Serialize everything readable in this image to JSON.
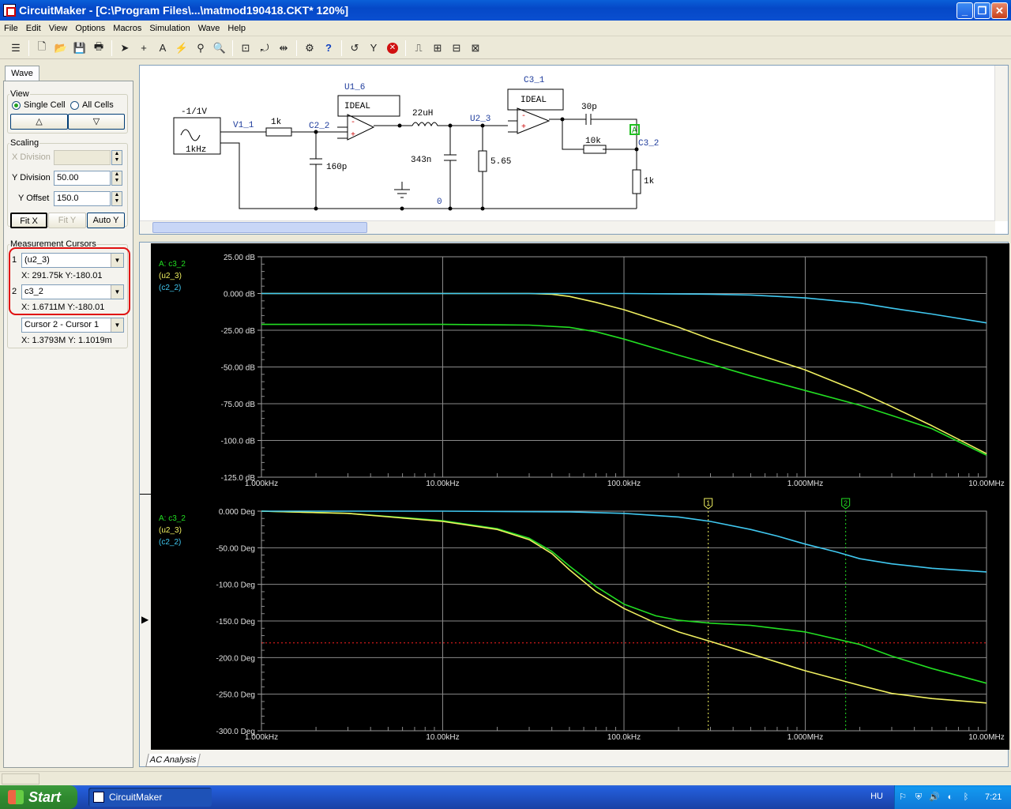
{
  "window": {
    "title": "CircuitMaker - [C:\\Program Files\\...\\matmod190418.CKT* 120%]",
    "minimize": "_",
    "restore": "❐",
    "close": "✕"
  },
  "menu": [
    "File",
    "Edit",
    "View",
    "Options",
    "Macros",
    "Simulation",
    "Wave",
    "Help"
  ],
  "toolbar_icons": [
    "bus-icon",
    "new-file-icon",
    "open-folder-icon",
    "save-icon",
    "print-icon",
    "arrow-tool-icon",
    "wire-tool-icon",
    "text-tool-icon",
    "probe-tool-icon",
    "zoom-tool-icon",
    "magnifier-icon",
    "zoom-to-fit-icon",
    "rotate-icon",
    "mirror-icon",
    "digital-sim-icon",
    "help-icon",
    "reset-icon",
    "step-icon",
    "stop-icon",
    "trace-icon",
    "waveform-icon",
    "scope-icon",
    "analog-icon"
  ],
  "left_panel": {
    "tab": "Wave",
    "view": {
      "legend": "View",
      "single_cell": "Single Cell",
      "all_cells": "All Cells",
      "up": "△",
      "down": "▽"
    },
    "scaling": {
      "legend": "Scaling",
      "x_division_label": "X Division",
      "x_division_value": "",
      "y_division_label": "Y Division",
      "y_division_value": "50.00",
      "y_offset_label": "Y Offset",
      "y_offset_value": "150.0",
      "fit_x": "Fit X",
      "fit_y": "Fit Y",
      "auto_y": "Auto Y"
    },
    "cursors": {
      "legend": "Measurement Cursors",
      "c1_num": "1",
      "c1_signal": "(u2_3)",
      "c1_readout": "X: 291.75k  Y:-180.01",
      "c2_num": "2",
      "c2_signal": "c3_2",
      "c2_readout": "X: 1.6711M  Y:-180.01",
      "diff_mode": "Cursor 2 - Cursor 1",
      "diff_readout": "X: 1.3793M  Y: 1.1019m"
    }
  },
  "schematic": {
    "source_amp": "-1/1V",
    "source_freq": "1kHz",
    "net_v1": "V1_1",
    "r1": "1k",
    "net_c22": "C2_2",
    "c1": "160p",
    "u1": "U1_6",
    "u1_type": "IDEAL",
    "l1": "22uH",
    "c2": "343n",
    "ground_net": "0",
    "net_u23": "U2_3",
    "r2": "5.65",
    "u2": "C3_1",
    "u2_type": "IDEAL",
    "c3": "30p",
    "r3": "10k",
    "probe": "A",
    "net_c32": "C3_2",
    "r4": "1k"
  },
  "colors": {
    "green": "#22dd22",
    "yellow": "#f0f060",
    "cyan": "#40c8f0",
    "red_cursor": "#ff2020"
  },
  "chart_data": [
    {
      "type": "line",
      "title": "",
      "xscale": "log",
      "xlim": [
        1000,
        10000000
      ],
      "ylim": [
        -125,
        25
      ],
      "x_ticks": [
        "1.000kHz",
        "10.00kHz",
        "100.0kHz",
        "1.000MHz",
        "10.00MHz"
      ],
      "y_ticks": [
        "25.00 dB",
        "0.000 dB",
        "-25.00 dB",
        "-50.00 dB",
        "-75.00 dB",
        "-100.0 dB",
        "-125.0 dB"
      ],
      "legend": [
        "A: c3_2",
        "(u2_3)",
        "(c2_2)"
      ],
      "series": [
        {
          "name": "A: c3_2",
          "color": "#22dd22",
          "x": [
            1000,
            10000,
            30000,
            50000,
            70000,
            100000,
            200000,
            300000,
            500000,
            1000000,
            2000000,
            3000000,
            5000000,
            10000000
          ],
          "y": [
            -21,
            -21,
            -21.5,
            -23,
            -26,
            -31,
            -42,
            -48,
            -56,
            -66,
            -76,
            -83,
            -92,
            -110
          ]
        },
        {
          "name": "(u2_3)",
          "color": "#f0f060",
          "x": [
            1000,
            10000,
            30000,
            40000,
            50000,
            70000,
            100000,
            200000,
            300000,
            500000,
            1000000,
            2000000,
            3000000,
            5000000,
            10000000
          ],
          "y": [
            0,
            0,
            0,
            -0.5,
            -2,
            -6,
            -11,
            -23,
            -31,
            -40,
            -52,
            -67,
            -77,
            -90,
            -109
          ]
        },
        {
          "name": "(c2_2)",
          "color": "#40c8f0",
          "x": [
            1000,
            10000,
            100000,
            200000,
            300000,
            500000,
            700000,
            1000000,
            2000000,
            3000000,
            5000000,
            10000000
          ],
          "y": [
            0,
            0,
            0,
            -0.3,
            -0.5,
            -1,
            -2,
            -3,
            -6.5,
            -10,
            -14,
            -20
          ]
        }
      ]
    },
    {
      "type": "line",
      "title": "",
      "xscale": "log",
      "xlim": [
        1000,
        10000000
      ],
      "ylim": [
        -300,
        0
      ],
      "x_ticks": [
        "1.000kHz",
        "10.00kHz",
        "100.0kHz",
        "1.000MHz",
        "10.00MHz"
      ],
      "y_ticks": [
        "0.000 Deg",
        "-50.00 Deg",
        "-100.0 Deg",
        "-150.0 Deg",
        "-200.0 Deg",
        "-250.0 Deg",
        "-300.0 Deg"
      ],
      "legend": [
        "A: c3_2",
        "(u2_3)",
        "(c2_2)"
      ],
      "cursors": [
        {
          "label": "1",
          "x": 291750
        },
        {
          "label": "2",
          "x": 1671100
        }
      ],
      "ref_line_y": -180,
      "series": [
        {
          "name": "A: c3_2",
          "color": "#22dd22",
          "x": [
            1000,
            3000,
            10000,
            20000,
            30000,
            40000,
            50000,
            70000,
            100000,
            150000,
            200000,
            300000,
            500000,
            1000000,
            2000000,
            3000000,
            5000000,
            10000000
          ],
          "y": [
            0,
            -3,
            -13,
            -24,
            -37,
            -55,
            -75,
            -103,
            -127,
            -143,
            -149,
            -153,
            -156,
            -165,
            -182,
            -198,
            -215,
            -235
          ]
        },
        {
          "name": "(u2_3)",
          "color": "#f0f060",
          "x": [
            1000,
            3000,
            10000,
            20000,
            30000,
            40000,
            50000,
            70000,
            100000,
            150000,
            200000,
            300000,
            500000,
            1000000,
            2000000,
            3000000,
            5000000,
            10000000
          ],
          "y": [
            0,
            -3,
            -14,
            -25,
            -39,
            -58,
            -80,
            -110,
            -133,
            -153,
            -165,
            -178,
            -195,
            -218,
            -238,
            -249,
            -256,
            -262
          ]
        },
        {
          "name": "(c2_2)",
          "color": "#40c8f0",
          "x": [
            1000,
            10000,
            50000,
            100000,
            200000,
            300000,
            500000,
            700000,
            1000000,
            1500000,
            2000000,
            3000000,
            5000000,
            10000000
          ],
          "y": [
            0,
            0,
            -1,
            -3,
            -8,
            -14,
            -25,
            -34,
            -45,
            -56,
            -65,
            -72,
            -78,
            -83
          ]
        }
      ]
    }
  ],
  "bottom_tab": "AC Analysis",
  "taskbar": {
    "start": "Start",
    "task": "CircuitMaker",
    "lang": "HU",
    "clock": "7:21"
  }
}
